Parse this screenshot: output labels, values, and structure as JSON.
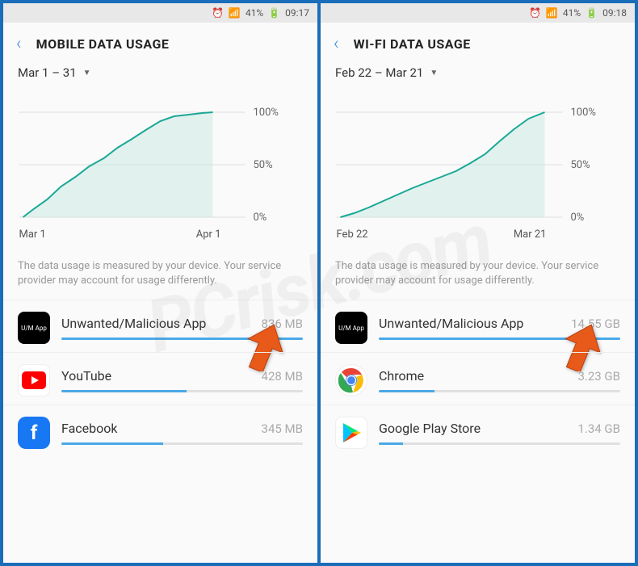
{
  "left": {
    "status": {
      "battery": "41%",
      "time": "09:17"
    },
    "title": "MOBILE DATA USAGE",
    "date_range": "Mar 1 – 31",
    "x_start": "Mar 1",
    "x_end": "Apr 1",
    "note": "The data usage is measured by your device. Your service provider may account for usage differently.",
    "apps": [
      {
        "name": "Unwanted/Malicious App",
        "size": "836 MB",
        "pct": 100,
        "icon": "umapp"
      },
      {
        "name": "YouTube",
        "size": "428 MB",
        "pct": 52,
        "icon": "youtube"
      },
      {
        "name": "Facebook",
        "size": "345 MB",
        "pct": 42,
        "icon": "facebook"
      }
    ]
  },
  "right": {
    "status": {
      "battery": "41%",
      "time": "09:18"
    },
    "title": "WI-FI DATA USAGE",
    "date_range": "Feb 22 – Mar 21",
    "x_start": "Feb 22",
    "x_end": "Mar 21",
    "note": "The data usage is measured by your device. Your service provider may account for usage differently.",
    "apps": [
      {
        "name": "Unwanted/Malicious App",
        "size": "14.55 GB",
        "pct": 100,
        "icon": "umapp"
      },
      {
        "name": "Chrome",
        "size": "3.23 GB",
        "pct": 23,
        "icon": "chrome"
      },
      {
        "name": "Google Play Store",
        "size": "1.34 GB",
        "pct": 10,
        "icon": "play"
      }
    ]
  },
  "y_ticks": [
    "100%",
    "50%",
    "0%"
  ],
  "chart_data": [
    {
      "type": "line",
      "title": "MOBILE DATA USAGE",
      "xlabel": "",
      "ylabel": "",
      "ylim": [
        0,
        100
      ],
      "x_range": [
        "Mar 1",
        "Apr 1"
      ],
      "x": [
        0,
        2,
        4,
        6,
        8,
        10,
        12,
        14,
        16,
        18,
        20,
        22,
        24,
        26,
        28,
        30
      ],
      "values": [
        0,
        8,
        20,
        32,
        42,
        52,
        60,
        70,
        78,
        85,
        92,
        96,
        98,
        99,
        100,
        100
      ]
    },
    {
      "type": "line",
      "title": "WI-FI DATA USAGE",
      "xlabel": "",
      "ylabel": "",
      "ylim": [
        0,
        100
      ],
      "x_range": [
        "Feb 22",
        "Mar 21"
      ],
      "x": [
        0,
        2,
        4,
        6,
        8,
        10,
        12,
        14,
        16,
        18,
        20,
        22,
        24,
        26,
        28
      ],
      "values": [
        0,
        4,
        9,
        15,
        22,
        28,
        33,
        38,
        44,
        52,
        60,
        72,
        84,
        94,
        100
      ]
    }
  ],
  "watermark": "PCrisk.com"
}
